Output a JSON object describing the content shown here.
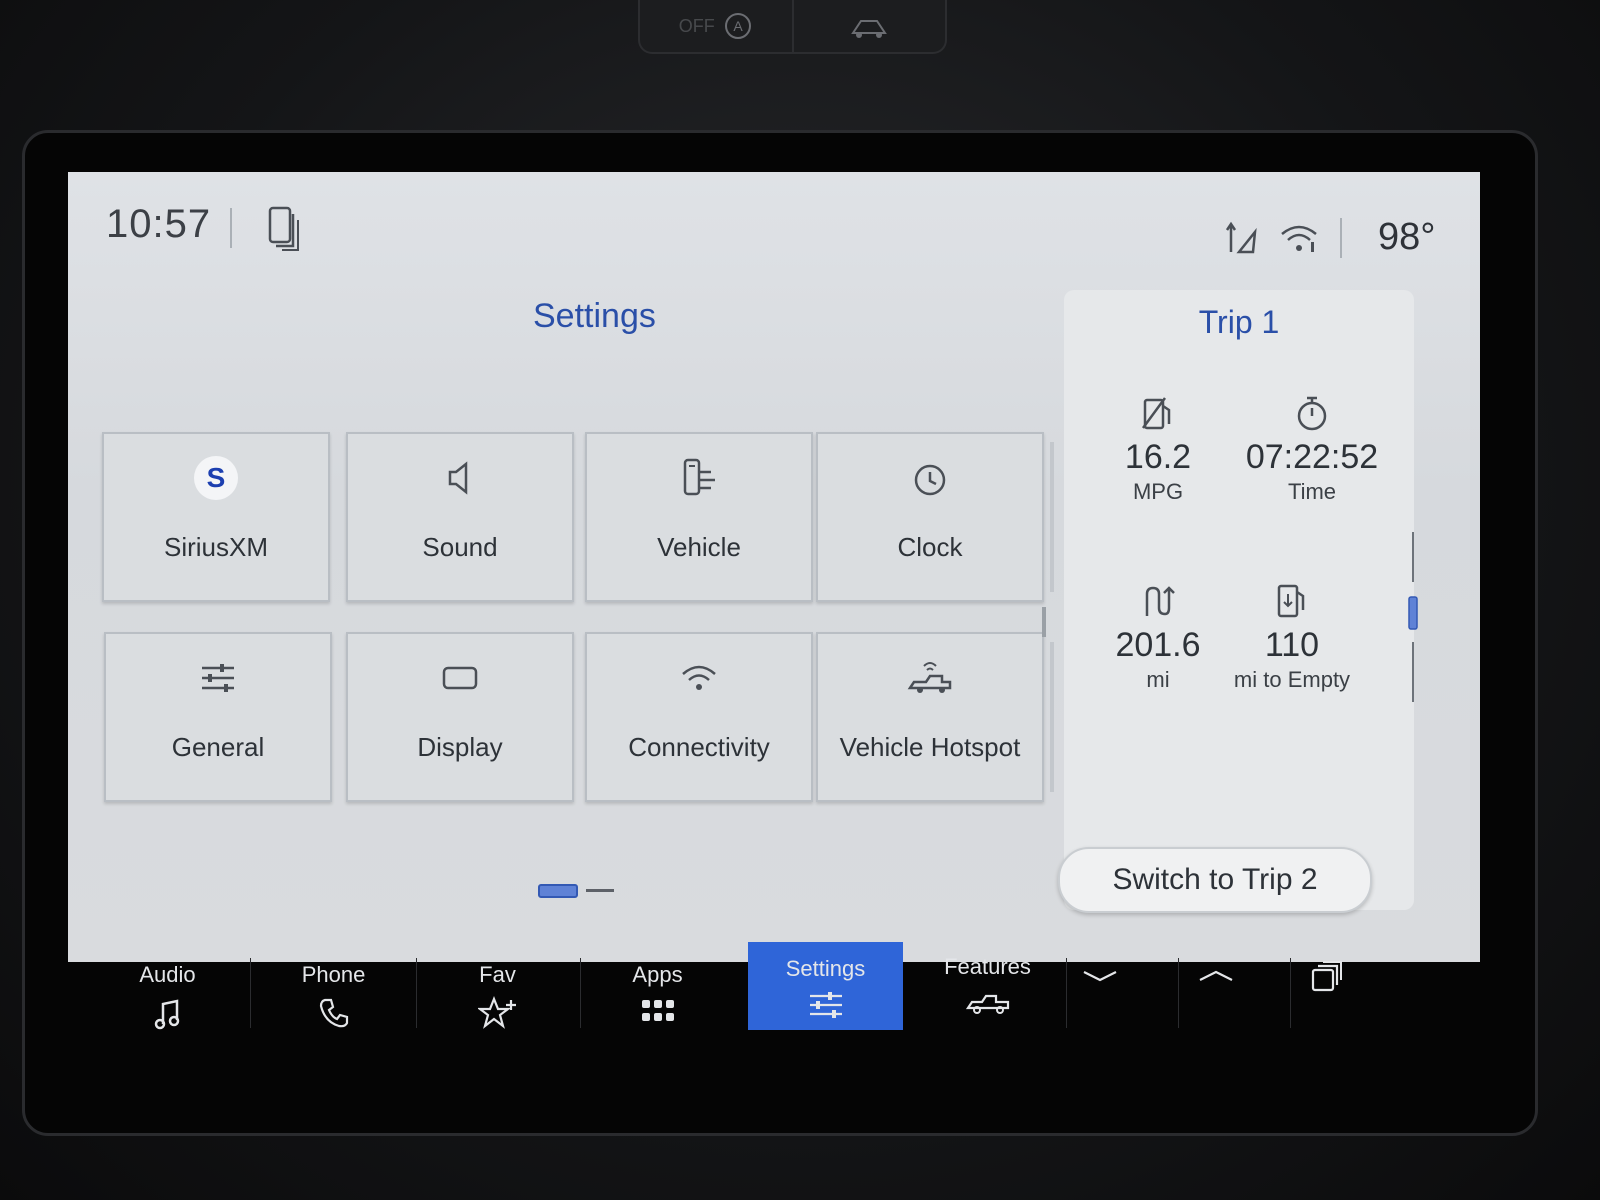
{
  "status": {
    "time": "10:57",
    "temperature": "98°"
  },
  "page": {
    "title": "Settings"
  },
  "tiles": [
    {
      "label": "SiriusXM",
      "icon": "siriusxm-icon"
    },
    {
      "label": "Sound",
      "icon": "speaker-icon"
    },
    {
      "label": "Vehicle",
      "icon": "vehicle-settings-icon"
    },
    {
      "label": "Clock",
      "icon": "clock-icon"
    },
    {
      "label": "General",
      "icon": "sliders-icon"
    },
    {
      "label": "Display",
      "icon": "display-icon"
    },
    {
      "label": "Connectivity",
      "icon": "wifi-icon"
    },
    {
      "label": "Vehicle Hotspot",
      "icon": "hotspot-truck-icon"
    }
  ],
  "trip": {
    "title": "Trip 1",
    "stats": [
      {
        "value": "16.2",
        "unit": "MPG",
        "icon": "fuel-economy-icon"
      },
      {
        "value": "07:22:52",
        "unit": "Time",
        "icon": "stopwatch-icon"
      },
      {
        "value": "201.6",
        "unit": "mi",
        "icon": "distance-icon"
      },
      {
        "value": "110",
        "unit": "mi to Empty",
        "icon": "fuel-pump-icon"
      }
    ],
    "switch_label": "Switch to Trip 2"
  },
  "nav": [
    {
      "label": "Audio",
      "icon": "music-note-icon"
    },
    {
      "label": "Phone",
      "icon": "phone-icon"
    },
    {
      "label": "Fav",
      "icon": "star-plus-icon"
    },
    {
      "label": "Apps",
      "icon": "apps-grid-icon"
    },
    {
      "label": "Settings",
      "icon": "sliders-icon",
      "active": true
    },
    {
      "label": "Features",
      "icon": "truck-icon"
    }
  ],
  "dash": {
    "left_label": "OFF"
  },
  "colors": {
    "accent": "#2a4fa8",
    "nav_active": "#2f65d8"
  }
}
